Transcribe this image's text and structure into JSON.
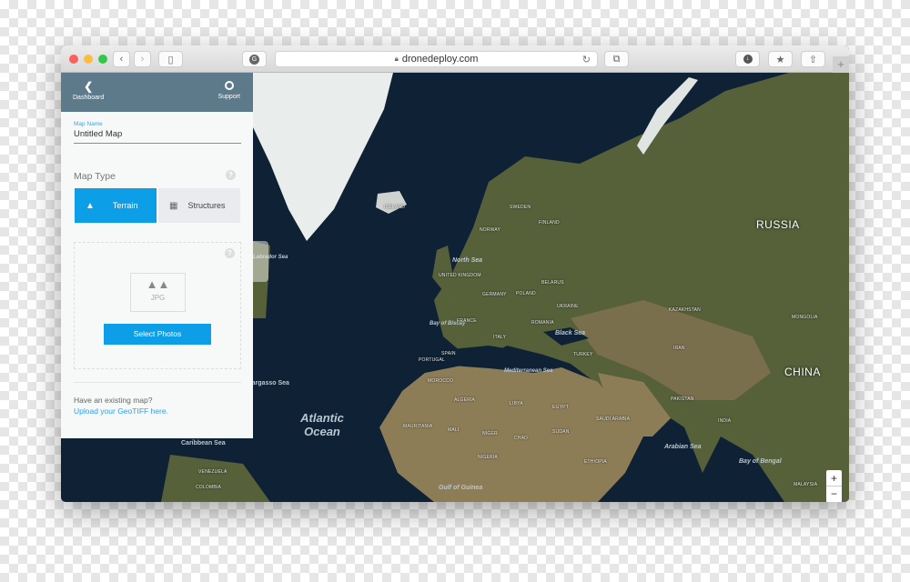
{
  "browser": {
    "url": "dronedeploy.com",
    "new_tab": "+"
  },
  "sidebar": {
    "dashboard_label": "Dashboard",
    "support_label": "Support",
    "map_name_label": "Map Name",
    "map_name_value": "Untitled Map",
    "map_type_label": "Map Type",
    "map_types": [
      {
        "label": "Terrain",
        "selected": true
      },
      {
        "label": "Structures",
        "selected": false
      }
    ],
    "file_type": "JPG",
    "select_photos": "Select Photos",
    "existing_map_text": "Have an existing map?",
    "upload_link": "Upload your GeoTIFF here.",
    "help": "?"
  },
  "map": {
    "countries_large": [
      "RUSSIA",
      "CHINA"
    ],
    "oceans": [
      "Atlantic Ocean"
    ],
    "seas": [
      "North Sea",
      "Bay of Biscay",
      "Black Sea",
      "Mediterranean Sea",
      "Arabian Sea",
      "Bay of Bengal",
      "Gulf of Guinea",
      "Caribbean Sea",
      "Sargasso Sea",
      "Labrador Sea"
    ],
    "countries": [
      "SWEDEN",
      "FINLAND",
      "NORWAY",
      "UNITED KINGDOM",
      "GERMANY",
      "POLAND",
      "BELARUS",
      "UKRAINE",
      "FRANCE",
      "ROMANIA",
      "ITALY",
      "SPAIN",
      "PORTUGAL",
      "TURKEY",
      "KAZAKHSTAN",
      "MONGOLIA",
      "INDIA",
      "MOROCCO",
      "ALGERIA",
      "LIBYA",
      "EGYPT",
      "SAUDI ARABIA",
      "MALI",
      "NIGER",
      "CHAD",
      "SUDAN",
      "NIGERIA",
      "ETHIOPIA",
      "MAURITANIA",
      "VENEZUELA",
      "COLOMBIA",
      "ICELAND",
      "IRAN",
      "PAKISTAN",
      "MALAYSIA"
    ],
    "zoom_in": "+",
    "zoom_out": "−",
    "colors": {
      "ocean": "#0f2235",
      "land": "#5a5b3d",
      "desert": "#8c7d57",
      "ice": "#e9edec",
      "accent": "#0d9ee8"
    }
  }
}
